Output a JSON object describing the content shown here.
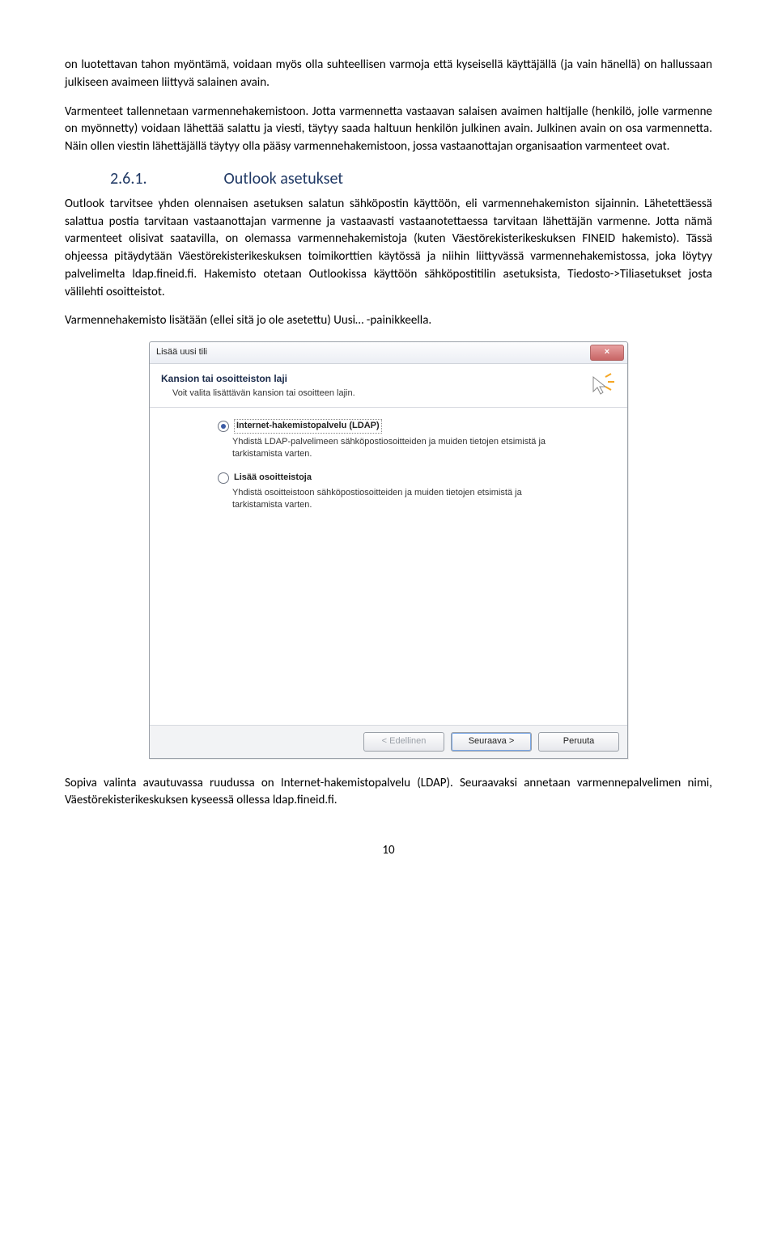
{
  "para1": "on luotettavan tahon myöntämä, voidaan myös olla suhteellisen varmoja että kyseisellä käyttäjällä (ja vain hänellä) on hallussaan julkiseen avaimeen liittyvä salainen avain.",
  "para2": "Varmenteet tallennetaan varmennehakemistoon. Jotta varmennetta vastaavan salaisen avaimen haltijalle (henkilö, jolle varmenne on myönnetty) voidaan lähettää salattu ja viesti, täytyy saada haltuun henkilön julkinen avain. Julkinen avain on osa varmennetta. Näin ollen viestin lähettäjällä täytyy olla pääsy varmennehakemistoon, jossa vastaanottajan organisaation varmenteet ovat.",
  "section": {
    "num": "2.6.1.",
    "title": "Outlook asetukset"
  },
  "para3": "Outlook tarvitsee yhden olennaisen asetuksen salatun sähköpostin käyttöön, eli varmennehakemiston sijainnin. Lähetettäessä salattua postia tarvitaan vastaanottajan varmenne ja vastaavasti vastaanotettaessa tarvitaan lähettäjän varmenne. Jotta nämä varmenteet olisivat saatavilla, on olemassa varmennehakemistoja (kuten Väestörekisterikeskuksen FINEID hakemisto). Tässä ohjeessa pitäydytään Väestörekisterikeskuksen toimikorttien käytössä ja niihin liittyvässä varmennehakemistossa, joka löytyy palvelimelta ldap.fineid.fi. Hakemisto otetaan Outlookissa käyttöön sähköpostitilin asetuksista, Tiedosto->Tiliasetukset josta välilehti osoitteistot.",
  "para4": "Varmennehakemisto lisätään (ellei sitä jo ole asetettu) Uusi… -painikkeella.",
  "dialog": {
    "title": "Lisää uusi tili",
    "close": "×",
    "hdr_title": "Kansion tai osoitteiston laji",
    "hdr_sub": "Voit valita lisättävän kansion tai osoitteen lajin.",
    "opt1": {
      "label": "Internet-hakemistopalvelu (LDAP)",
      "desc": "Yhdistä LDAP-palvelimeen sähköpostiosoitteiden ja muiden tietojen etsimistä ja tarkistamista varten."
    },
    "opt2": {
      "label": "Lisää osoitteistoja",
      "desc": "Yhdistä osoitteistoon sähköpostiosoitteiden ja muiden tietojen etsimistä ja tarkistamista varten."
    },
    "btn_prev": "< Edellinen",
    "btn_next": "Seuraava >",
    "btn_cancel": "Peruuta"
  },
  "para5": "Sopiva valinta avautuvassa ruudussa on Internet-hakemistopalvelu (LDAP). Seuraavaksi annetaan varmennepalvelimen nimi, Väestörekisterikeskuksen kyseessä ollessa ldap.fineid.fi.",
  "pagenum": "10"
}
